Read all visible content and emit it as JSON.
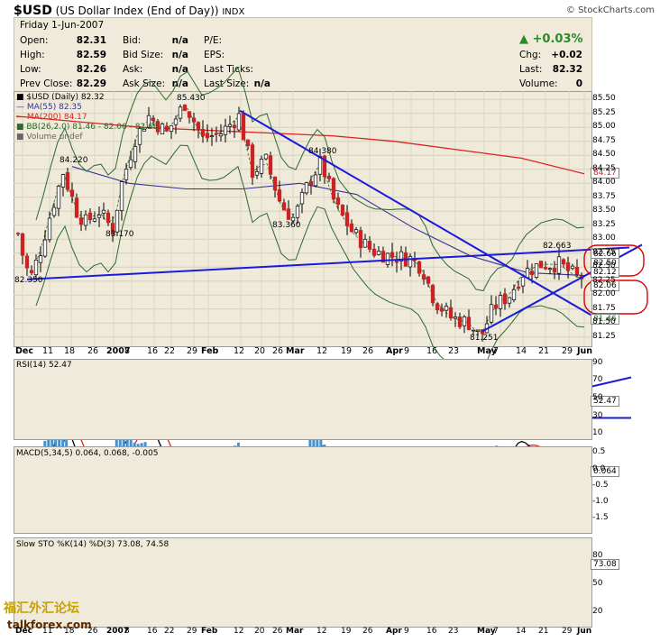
{
  "header": {
    "symbol": "$USD",
    "name": "(US Dollar Index (End of Day))",
    "exchange": "INDX",
    "source": "© StockCharts.com"
  },
  "quote": {
    "date": "Friday  1-Jun-2007",
    "open_label": "Open:",
    "open": "82.31",
    "high_label": "High:",
    "high": "82.59",
    "low_label": "Low:",
    "low": "82.26",
    "prev_label": "Prev Close:",
    "prev": "82.29",
    "bid_label": "Bid:",
    "bid": "n/a",
    "bidsize_label": "Bid Size:",
    "bidsize": "n/a",
    "ask_label": "Ask:",
    "ask": "n/a",
    "asksize_label": "Ask Size:",
    "asksize": "n/a",
    "pe_label": "P/E:",
    "eps_label": "EPS:",
    "lastticks_label": "Last Ticks:",
    "lastsize_label": "Last Size:",
    "lastsize": "n/a",
    "pct_change": "▲ +0.03%",
    "chg_label": "Chg:",
    "chg": "+0.02",
    "last_label": "Last:",
    "last": "82.32",
    "volume_label": "Volume:",
    "volume": "0"
  },
  "legend": {
    "price": "■ $USD (Daily) 82.32",
    "ma55": "— MA(55) 82.35",
    "ma200": "— MA(200) 84.17",
    "bb": "■ BB(26,2.0) 81.46 - 82.06 - 82.66",
    "volume": "■ Volume undef"
  },
  "annotations": {
    "a1": "85.430",
    "a2": "84.220",
    "a3": "84.380",
    "a4": "83.360",
    "a5": "83.170",
    "a6": "82.350",
    "a7": "81.251",
    "a8": "82.663"
  },
  "price_axis": [
    "85.50",
    "85.25",
    "85.00",
    "84.75",
    "84.50",
    "84.25",
    "84.00",
    "83.75",
    "83.50",
    "83.25",
    "83.00",
    "82.75",
    "82.50",
    "82.25",
    "82.00",
    "81.75",
    "81.50",
    "81.25"
  ],
  "price_tags": {
    "t1": "84.17",
    "t2": "82.66",
    "t3": "82.50",
    "t4": "82.12",
    "t5": "82.06",
    "t6": "81.46"
  },
  "x_labels": [
    "Dec",
    "11",
    "18",
    "26",
    "2007",
    "8",
    "16",
    "22",
    "29",
    "Feb",
    "12",
    "20",
    "26",
    "Mar",
    "12",
    "19",
    "26",
    "Apr",
    "9",
    "16",
    "23",
    "May",
    "7",
    "14",
    "21",
    "29",
    "Jun"
  ],
  "rsi": {
    "label": "RSI(14) 52.47",
    "axis": [
      "90",
      "70",
      "50",
      "30",
      "10"
    ],
    "tag": "52.47"
  },
  "macd": {
    "label": "MACD(5,34,5) 0.064, 0.068, -0.005",
    "axis": [
      "0.5",
      "0.0",
      "-0.5",
      "-1.0",
      "-1.5"
    ],
    "tag": "0.064"
  },
  "sto": {
    "label": "Slow STO %K(14) %D(3) 73.08, 74.58",
    "axis": [
      "80",
      "73.08",
      "50",
      "20"
    ],
    "tag": "73.08"
  },
  "watermark": {
    "cn": "福汇外汇论坛",
    "site": "talkforex.com"
  },
  "colors": {
    "up": "#ffffff",
    "down": "#cc2222",
    "ma55": "#333399",
    "ma200": "#dd2222",
    "bb": "#2b6b2b",
    "trend": "#1a1add",
    "circle": "#dd0000"
  },
  "chart_data": {
    "type": "candlestick",
    "title": "$USD (US Dollar Index (End of Day)) INDX",
    "ylim": [
      81.1,
      85.65
    ],
    "indicators": [
      "MA(55)",
      "MA(200)",
      "BB(26,2.0)",
      "RSI(14)",
      "MACD(5,34,5)",
      "Slow STO %K(14) %D(3)"
    ],
    "last": {
      "open": 82.31,
      "high": 82.59,
      "low": 82.26,
      "close": 82.32
    },
    "annotated_extremes": [
      85.43,
      84.22,
      84.38,
      83.36,
      83.17,
      82.35,
      81.251,
      82.663
    ],
    "ma200_series": [
      85.2,
      85.1,
      85.0,
      84.95,
      84.9,
      84.85,
      84.75,
      84.6,
      84.45,
      84.17
    ],
    "ma55_series": [
      84.3,
      84.0,
      83.9,
      83.9,
      84.0,
      83.8,
      83.2,
      82.7,
      82.4,
      82.35
    ]
  }
}
